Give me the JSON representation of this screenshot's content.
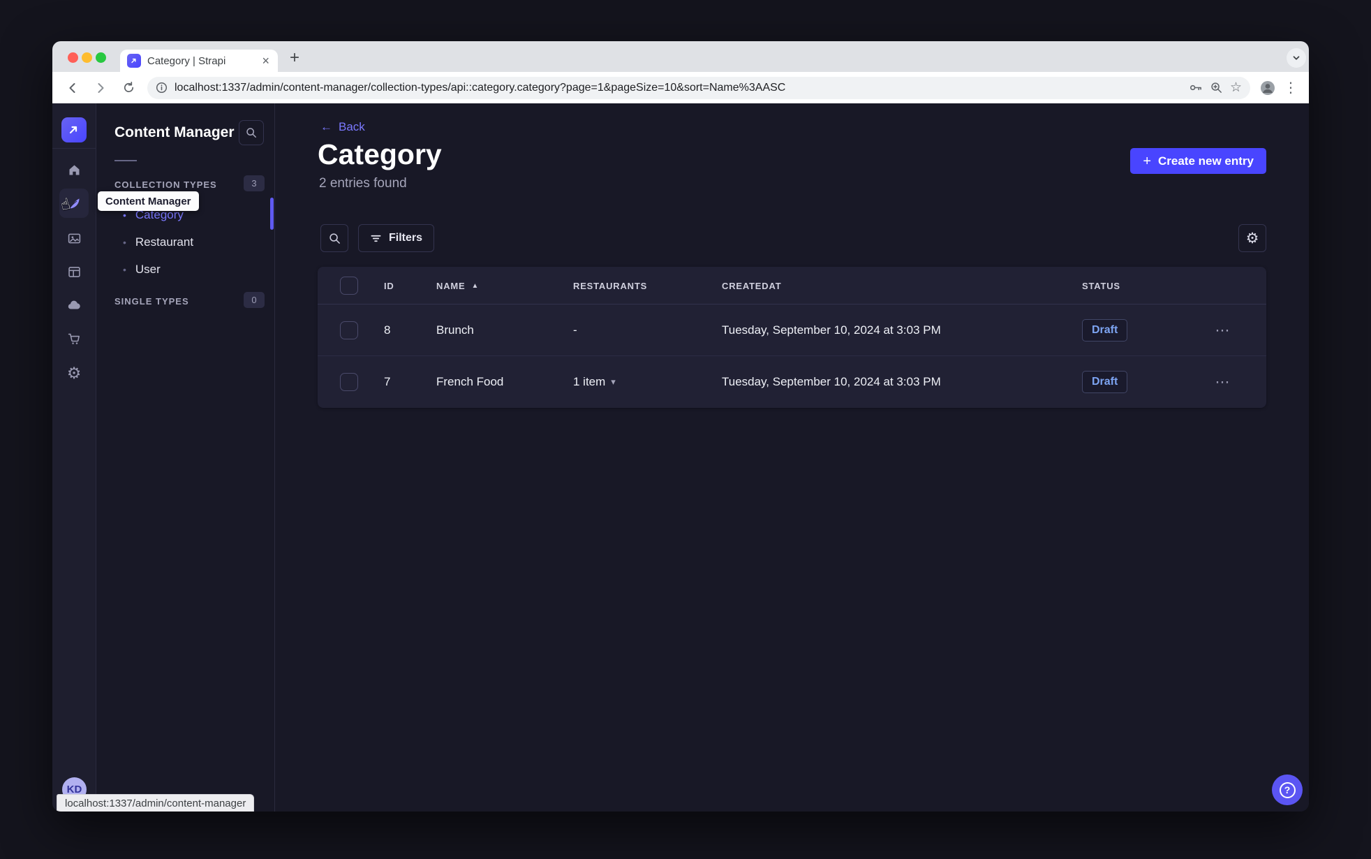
{
  "browser": {
    "tab_title": "Category | Strapi",
    "url": "localhost:1337/admin/content-manager/collection-types/api::category.category?page=1&pageSize=10&sort=Name%3AASC",
    "status_bar_url": "localhost:1337/admin/content-manager"
  },
  "sidebar": {
    "tooltip": "Content Manager",
    "user_initials": "KD",
    "icons": [
      "strapi-logo",
      "home",
      "content-manager",
      "media-library",
      "content-type-builder",
      "cloud",
      "marketplace",
      "settings"
    ]
  },
  "subnav": {
    "title": "Content Manager",
    "collection_types": {
      "label": "COLLECTION TYPES",
      "count": "3",
      "items": [
        "Category",
        "Restaurant",
        "User"
      ],
      "active_item": "Category"
    },
    "single_types": {
      "label": "SINGLE TYPES",
      "count": "0"
    }
  },
  "main": {
    "back_label": "Back",
    "title": "Category",
    "subtitle": "2 entries found",
    "create_button_label": "Create new entry",
    "filters_label": "Filters",
    "table": {
      "headers": {
        "id": "ID",
        "name": "NAME",
        "restaurants": "RESTAURANTS",
        "createdat": "CREATEDAT",
        "status": "STATUS"
      },
      "sort_column": "NAME",
      "sort_direction": "ASC",
      "rows": [
        {
          "id": "8",
          "name": "Brunch",
          "restaurants": "-",
          "createdat": "Tuesday, September 10, 2024 at 3:03 PM",
          "status": "Draft"
        },
        {
          "id": "7",
          "name": "French Food",
          "restaurants": "1 item",
          "createdat": "Tuesday, September 10, 2024 at 3:03 PM",
          "status": "Draft"
        }
      ]
    }
  },
  "glyphs": {
    "tab_close": "×",
    "new_tab": "+",
    "plus": "+",
    "star": "☆",
    "menu_vertical": "⋮",
    "overflow": "⋯",
    "back_arrow": "←",
    "bullet": "•",
    "sort_asc": "▲",
    "caret_down": "▾",
    "gear": "⚙",
    "question": "?",
    "cursor_hand": "☝"
  },
  "colors": {
    "accent": "#4945ff",
    "accent_light": "#7b79ff",
    "app_background": "#181826",
    "card_background": "#212134",
    "draft_text": "#7da4f2",
    "muted_text": "#a5a5ba"
  }
}
